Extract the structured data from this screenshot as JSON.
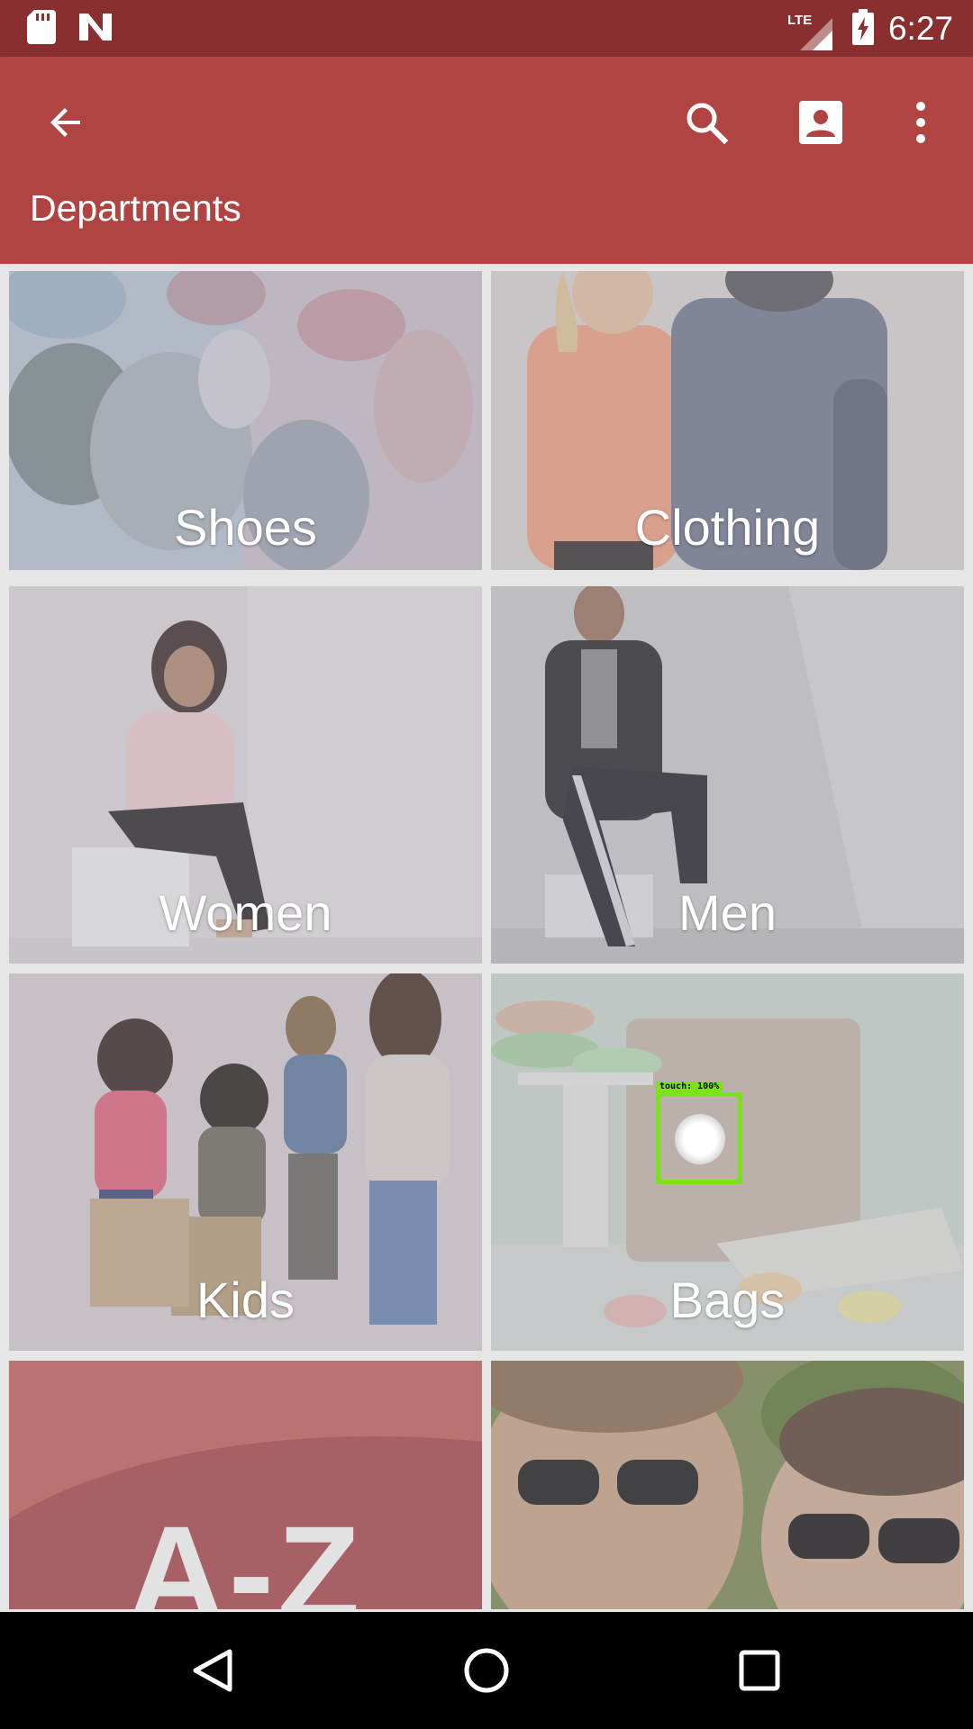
{
  "status_bar": {
    "network_label": "LTE",
    "time": "6:27",
    "icons": [
      "sd-card-icon",
      "notification-n-icon",
      "signal-icon",
      "battery-charging-icon"
    ]
  },
  "app_bar": {
    "title": "Departments",
    "icons": [
      "arrow-back-icon",
      "search-icon",
      "account-box-icon",
      "more-vert-icon"
    ]
  },
  "departments": [
    {
      "label": "Shoes"
    },
    {
      "label": "Clothing"
    },
    {
      "label": "Women"
    },
    {
      "label": "Men"
    },
    {
      "label": "Kids"
    },
    {
      "label": "Bags"
    },
    {
      "label": "A-Z"
    },
    {
      "label": ""
    }
  ],
  "touch_indicator": {
    "label": "touch: 100%",
    "color": "#7ee21b"
  },
  "nav_bar": {
    "icons": [
      "nav-back-icon",
      "nav-home-icon",
      "nav-recents-icon"
    ]
  },
  "colors": {
    "status_bar": "#8a2f30",
    "app_bar": "#b04443",
    "grid_background": "#e6e6e6"
  }
}
